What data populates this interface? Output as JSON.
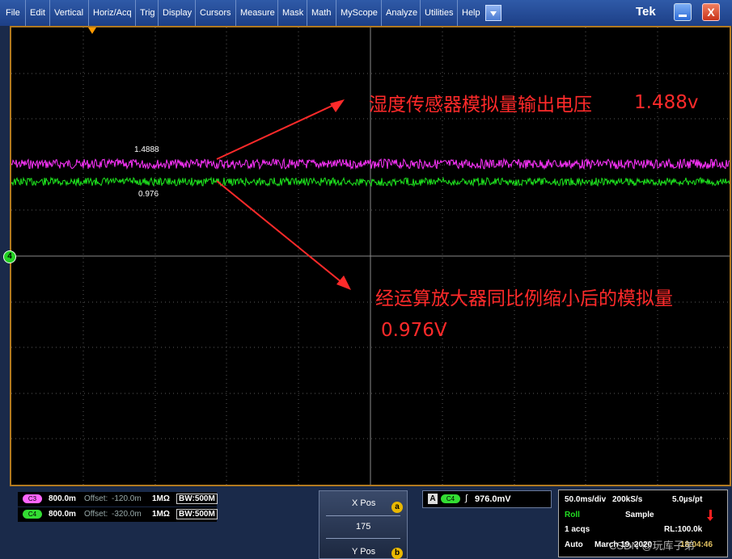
{
  "menu": {
    "items": [
      "File",
      "Edit",
      "Vertical",
      "Horiz/Acq",
      "Trig",
      "Display",
      "Cursors",
      "Measure",
      "Mask",
      "Math",
      "MyScope",
      "Analyze",
      "Utilities",
      "Help"
    ],
    "brand": "Tek",
    "close_symbol": "X"
  },
  "waveforms": {
    "ch3_label": "1.4888",
    "ch4_label": "0.976",
    "ch3_color": "#ff33ff",
    "ch4_color": "#1ee61e"
  },
  "annotations": {
    "top_text": "湿度传感器模拟量输出电压",
    "top_value": "1.488v",
    "bottom_text": "经运算放大器同比例缩小后的模拟量",
    "bottom_value": "0.976V",
    "color": "#ff2a2a"
  },
  "ch4_marker": "4",
  "channels": [
    {
      "tag": "C3",
      "scale": "800.0m",
      "offset_label": "Offset:",
      "offset": "-120.0m",
      "impedance": "1MΩ",
      "bw_label": "BW:",
      "bw": "500M",
      "color": "#ff66ff"
    },
    {
      "tag": "C4",
      "scale": "800.0m",
      "offset_label": "Offset:",
      "offset": "-320.0m",
      "impedance": "1MΩ",
      "bw_label": "BW:",
      "bw": "500M",
      "color": "#33dd33"
    }
  ],
  "position": {
    "xpos_label": "X Pos",
    "xpos_tag": "a",
    "xpos_value": "175",
    "ypos_label": "Y Pos",
    "ypos_tag": "b"
  },
  "trigger": {
    "mode": "A",
    "source": "C4",
    "slope": "∫",
    "level": "976.0mV"
  },
  "acquisition": {
    "time_div": "50.0ms/div",
    "sample_rate": "200kS/s",
    "resolution": "5.0µs/pt",
    "mode": "Roll",
    "sample": "Sample",
    "acqs": "1 acqs",
    "record_length": "RL:100.0k",
    "trigger_mode": "Auto",
    "date": "March 19, 2020",
    "time": "18:04:46",
    "watermark": "CSDN @玩库子弟",
    "roll_color": "#22dd22"
  }
}
